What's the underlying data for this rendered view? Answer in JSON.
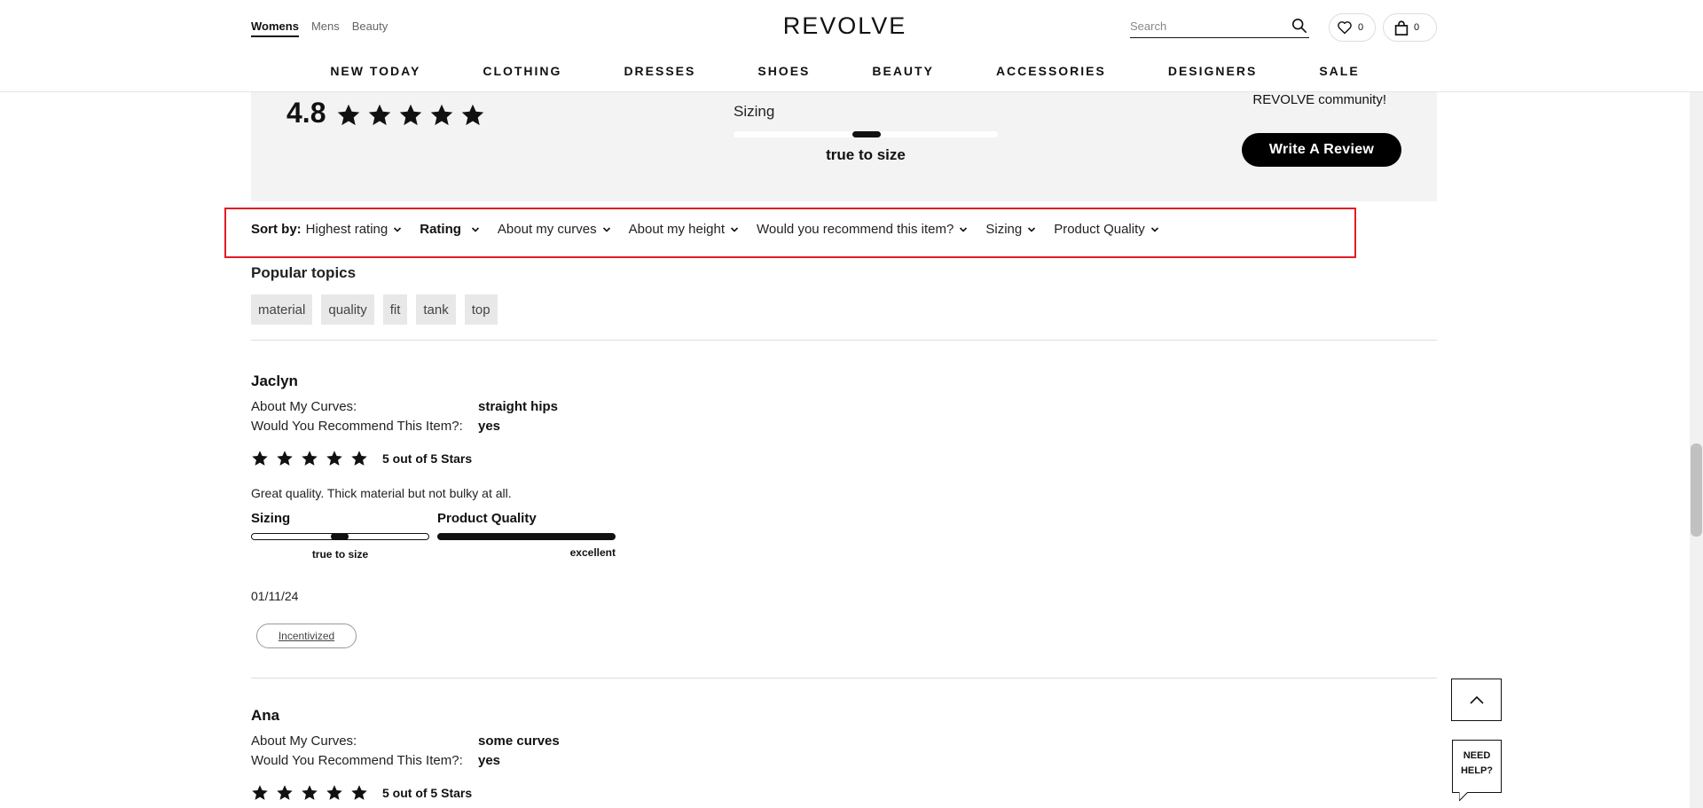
{
  "header": {
    "gender_tabs": [
      "Womens",
      "Mens",
      "Beauty"
    ],
    "logo": "REVOLVE",
    "search_placeholder": "Search",
    "wishlist_count": "0",
    "bag_count": "0",
    "categories": [
      "NEW TODAY",
      "CLOTHING",
      "DRESSES",
      "SHOES",
      "BEAUTY",
      "ACCESSORIES",
      "DESIGNERS",
      "SALE"
    ]
  },
  "summary": {
    "average_rating": "4.8",
    "sizing_label": "Sizing",
    "sizing_value": "true to size",
    "community_text": "REVOLVE community!",
    "write_review_label": "Write A Review"
  },
  "filters": {
    "sort_prefix": "Sort by:",
    "sort_value": "Highest rating",
    "rating": "Rating",
    "items": [
      "About my curves",
      "About my height",
      "Would you recommend this item?",
      "Sizing",
      "Product Quality"
    ]
  },
  "topics": {
    "title": "Popular topics",
    "items": [
      "material",
      "quality",
      "fit",
      "tank",
      "top"
    ]
  },
  "reviews": [
    {
      "name": "Jaclyn",
      "curves_key": "About My Curves:",
      "curves_value": "straight hips",
      "recommend_key": "Would You Recommend This Item?:",
      "recommend_value": "yes",
      "rating": 5,
      "rating_text": "5 out of 5 Stars",
      "body": "Great quality. Thick material but not bulky at all.",
      "sizing_label": "Sizing",
      "sizing_value": "true to size",
      "quality_label": "Product Quality",
      "quality_value": "excellent",
      "date": "01/11/24",
      "badge": "Incentivized"
    },
    {
      "name": "Ana",
      "curves_key": "About My Curves:",
      "curves_value": "some curves",
      "recommend_key": "Would You Recommend This Item?:",
      "recommend_value": "yes",
      "rating": 5,
      "rating_text": "5 out of 5 Stars"
    }
  ],
  "floating": {
    "need_help_line1": "NEED",
    "need_help_line2": "HELP?"
  }
}
